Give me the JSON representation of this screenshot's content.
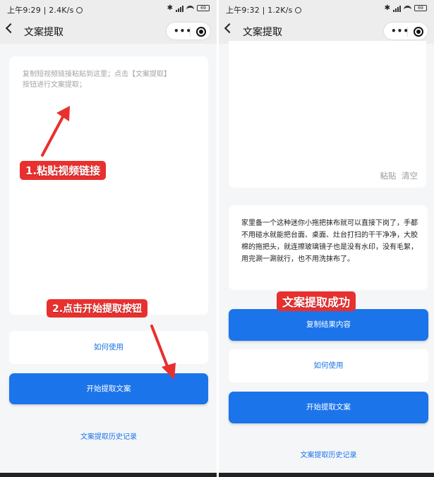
{
  "left": {
    "status": {
      "time": "上午9:29",
      "speed": "2.4K/s",
      "battery": "69"
    },
    "nav": {
      "title": "文案提取"
    },
    "input_placeholder": "复制短视频链接粘贴到这里；点击【文案提取】\n按钮进行文案提取；",
    "how_to_use_label": "如何使用",
    "start_button_label": "开始提取文案",
    "history_link": "文案提取历史记录",
    "annotation_1": "1.粘贴视频链接",
    "annotation_2": "2.点击开始提取按钮"
  },
  "right": {
    "status": {
      "time": "上午9:32",
      "speed": "1.2K/s",
      "battery": "69"
    },
    "nav": {
      "title": "文案提取"
    },
    "paste_label": "粘贴",
    "clear_label": "清空",
    "result_text": "家里备一个这种迷你小拖把抹布就可以直接下岗了，手都不用碰水就能把台面、桌面、灶台打扫的干干净净，大胶棉的拖把头，就连擦玻璃镜子也是没有水印，没有毛絮，用完涮一涮就行，也不用洗抹布了。",
    "copy_button_label": "复制结果内容",
    "how_to_use_label": "如何使用",
    "start_button_label": "开始提取文案",
    "history_link": "文案提取历史记录",
    "annotation_success": "文案提取成功"
  },
  "colors": {
    "accent": "#1b74ea",
    "annotation": "#e8302e",
    "page_bg": "#f5f6f7",
    "nav_bg": "#ededed"
  },
  "icons": [
    "back-chevron-icon",
    "more-dots-icon",
    "target-close-icon",
    "alarm-icon",
    "bluetooth-icon",
    "signal-icon",
    "wifi-icon",
    "battery-icon",
    "arrow-icon"
  ]
}
